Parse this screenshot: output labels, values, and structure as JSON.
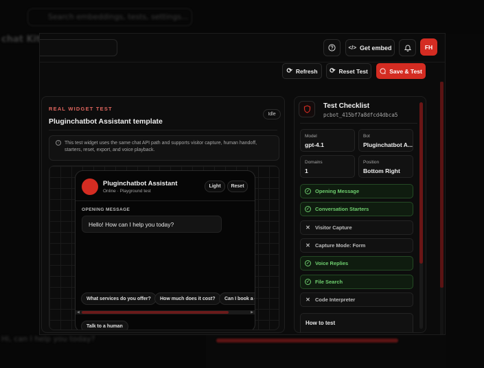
{
  "background": {
    "search_placeholder": "Search embeddings, tests, settings...",
    "title": "chat Kit",
    "snippet": "Hi, can I help you today?"
  },
  "topbar": {
    "help_icon": "question-circle-icon",
    "embed_label": "Get embed",
    "bell_icon": "bell-icon",
    "avatar_initials": "FH"
  },
  "actions": {
    "refresh": "Refresh",
    "reset_test": "Reset Test",
    "save_test": "Save & Test"
  },
  "widget_panel": {
    "overline": "REAL WIDGET TEST",
    "title": "Pluginchatbot Assistant template",
    "status": "Idle",
    "info": "This test widget uses the same chat API path and supports visitor capture, human handoff, starters, reset, export, and voice playback.",
    "widget": {
      "name": "Pluginchatbot Assistant",
      "subtitle": "Online · Playground test",
      "theme_button": "Light",
      "reset_button": "Reset",
      "opening_label": "OPENING MESSAGE",
      "opening_message": "Hello! How can I help you today?",
      "starters": [
        "What services do you offer?",
        "How much does it cost?",
        "Can I book a d"
      ],
      "human_button": "Talk to a human"
    }
  },
  "checklist": {
    "title": "Test Checklist",
    "bot_id": "pcbot_415bf7a8dfcd4dbca5",
    "stats": [
      {
        "label": "Model",
        "value": "gpt-4.1"
      },
      {
        "label": "Bot",
        "value": "Pluginchatbot A..."
      },
      {
        "label": "Domains",
        "value": "1"
      },
      {
        "label": "Position",
        "value": "Bottom Right"
      }
    ],
    "items": [
      {
        "label": "Opening Message",
        "done": true
      },
      {
        "label": "Conversation Starters",
        "done": true
      },
      {
        "label": "Visitor Capture",
        "done": false
      },
      {
        "label": "Capture Mode: Form",
        "done": false
      },
      {
        "label": "Voice Replies",
        "done": true
      },
      {
        "label": "File Search",
        "done": true
      },
      {
        "label": "Code Interpreter",
        "done": false
      }
    ],
    "how_to": "How to test"
  },
  "colors": {
    "accent": "#d42c22",
    "success": "#6fcf6f"
  }
}
